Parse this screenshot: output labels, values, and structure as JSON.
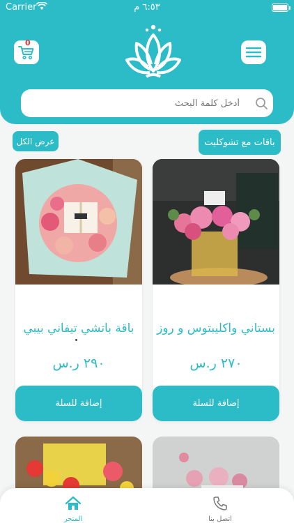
{
  "status_bar": {
    "carrier": "Carrier",
    "time": "٦:٥٣ م"
  },
  "header": {
    "cart_count": "0",
    "icons": {
      "cart": "cart-icon",
      "menu": "menu-icon",
      "logo": "lotus-logo"
    }
  },
  "search": {
    "placeholder": "أدخل كلمة البحث",
    "value": ""
  },
  "section": {
    "title": "باقات مع تشوكليت",
    "view_all": "عرض الكل"
  },
  "products": [
    {
      "name": "بستاني واكليبتوس و روز",
      "price": "٢٧٠ ر.س",
      "button": "إضافة للسلة"
    },
    {
      "name": "باقة باتشي تيفاني بيبي",
      "price": "٢٩٠ ر.س",
      "button": "إضافة للسلة"
    }
  ],
  "tabbar": {
    "tabs": [
      {
        "label": "المتجر",
        "icon": "home-icon",
        "active": true
      },
      {
        "label": "اتصل بنا",
        "icon": "phone-icon",
        "active": false
      }
    ]
  },
  "colors": {
    "accent": "#2cbcc8",
    "badge": "#e53935",
    "tab_inactive": "#777777"
  }
}
